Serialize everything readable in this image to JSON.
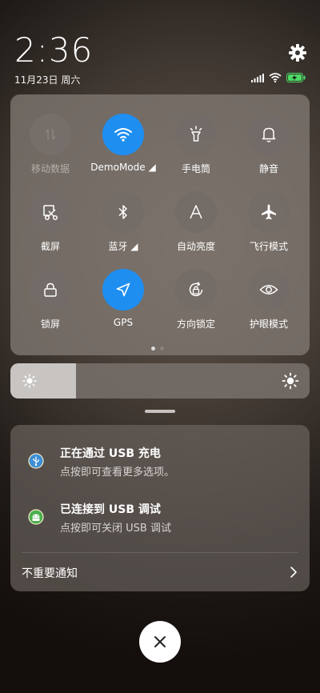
{
  "header": {
    "time": "2:36",
    "date": "11月23日 周六"
  },
  "toggles": [
    {
      "label": "移动数据",
      "icon": "mobile-data-icon",
      "state": "disabled"
    },
    {
      "label": "DemoMode ◢",
      "icon": "wifi-icon",
      "state": "active"
    },
    {
      "label": "手电筒",
      "icon": "flashlight-icon",
      "state": "off"
    },
    {
      "label": "静音",
      "icon": "bell-icon",
      "state": "off"
    },
    {
      "label": "截屏",
      "icon": "screenshot-icon",
      "state": "off"
    },
    {
      "label": "蓝牙 ◢",
      "icon": "bluetooth-icon",
      "state": "off"
    },
    {
      "label": "自动亮度",
      "icon": "auto-brightness-icon",
      "state": "off"
    },
    {
      "label": "飞行模式",
      "icon": "airplane-icon",
      "state": "off"
    },
    {
      "label": "锁屏",
      "icon": "lock-icon",
      "state": "off"
    },
    {
      "label": "GPS",
      "icon": "location-icon",
      "state": "active"
    },
    {
      "label": "方向锁定",
      "icon": "rotation-lock-icon",
      "state": "off"
    },
    {
      "label": "护眼模式",
      "icon": "eye-icon",
      "state": "off"
    }
  ],
  "brightness": {
    "level": 0.22
  },
  "notifications": [
    {
      "title": "正在通过 USB 充电",
      "subtitle": "点按即可查看更多选项。",
      "icon": "usb-icon",
      "color": "#3d8fd6"
    },
    {
      "title": "已连接到 USB 调试",
      "subtitle": "点按即可关闭 USB 调试",
      "icon": "android-icon",
      "color": "#4caf50"
    }
  ],
  "footer": {
    "unimportant_label": "不重要通知"
  },
  "colors": {
    "accent": "#1f8ef1"
  }
}
